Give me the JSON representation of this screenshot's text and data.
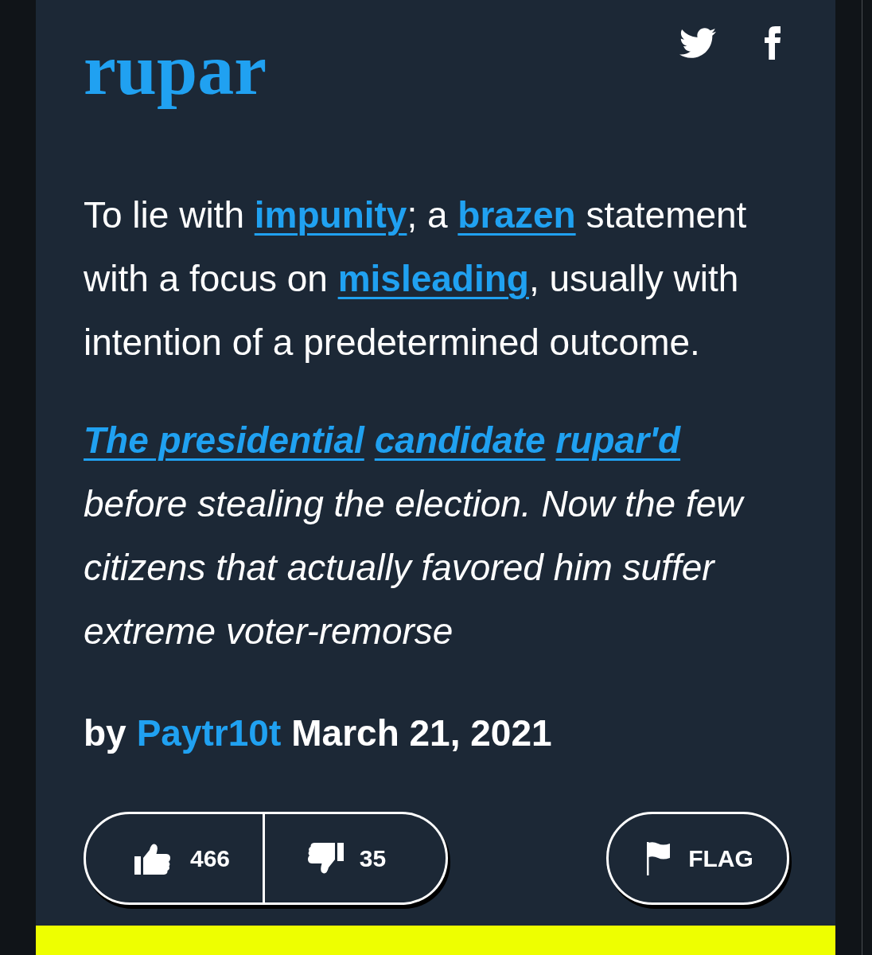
{
  "header": {
    "word": "rupar",
    "share": [
      {
        "kind": "twitter"
      },
      {
        "kind": "facebook"
      }
    ]
  },
  "definition": [
    {
      "kind": "text",
      "text": "To lie with "
    },
    {
      "kind": "link",
      "text": "impunity"
    },
    {
      "kind": "text",
      "text": "; a "
    },
    {
      "kind": "link",
      "text": "brazen"
    },
    {
      "kind": "text",
      "text": " statement with a focus on "
    },
    {
      "kind": "link",
      "text": "misleading"
    },
    {
      "kind": "text",
      "text": ", usually with intention of a predetermined outcome."
    }
  ],
  "example": [
    {
      "kind": "link",
      "text": "The presidential"
    },
    {
      "kind": "link",
      "text": "candidate"
    },
    {
      "kind": "link",
      "text": "rupar'd"
    },
    {
      "kind": "text",
      "text": " before stealing the election. Now the few citizens that actually favored him suffer extreme voter-remorse"
    }
  ],
  "byline": {
    "prefix": "by",
    "author": "Paytr10t",
    "date": "March 21, 2021"
  },
  "votes": [
    {
      "kind": "up",
      "count": "466"
    },
    {
      "kind": "down",
      "count": "35"
    }
  ],
  "flag": {
    "label": "FLAG"
  }
}
